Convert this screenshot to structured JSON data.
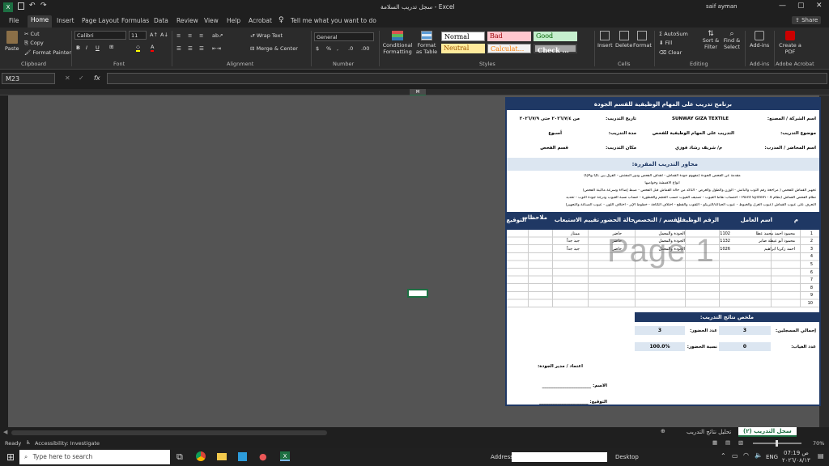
{
  "window": {
    "title": "سجل تدريب السلامة - Excel",
    "user": "saif ayman"
  },
  "menu_tabs": [
    "File",
    "Home",
    "Insert",
    "Page Layout",
    "Formulas",
    "Data",
    "Review",
    "View",
    "Help",
    "Acrobat"
  ],
  "active_tab": "Home",
  "tell_me": "Tell me what you want to do",
  "share": "Share",
  "ribbon": {
    "clipboard": {
      "paste": "Paste",
      "cut": "Cut",
      "copy": "Copy",
      "format_painter": "Format Painter",
      "group": "Clipboard"
    },
    "font": {
      "name": "Calibri",
      "size": "11",
      "group": "Font"
    },
    "alignment": {
      "wrap": "Wrap Text",
      "merge": "Merge & Center",
      "group": "Alignment"
    },
    "number": {
      "format": "General",
      "group": "Number"
    },
    "styles": {
      "conditional": "Conditional Formatting",
      "format_table": "Format as Table",
      "normal": "Normal",
      "bad": "Bad",
      "good": "Good",
      "neutral": "Neutral",
      "calculation": "Calculat...",
      "check": "Check ...",
      "group": "Styles"
    },
    "cells": {
      "insert": "Insert",
      "delete": "Delete",
      "format": "Format",
      "group": "Cells"
    },
    "editing": {
      "autosum": "AutoSum",
      "fill": "Fill",
      "clear": "Clear",
      "sort": "Sort & Filter",
      "find": "Find & Select",
      "group": "Editing"
    },
    "addins": {
      "label": "Add-ins",
      "group": "Add-ins"
    },
    "acrobat": {
      "label": "Create a PDF",
      "group": "Adobe Acrobat"
    }
  },
  "name_box": "M23",
  "fx": "fx",
  "cell_selected": "M",
  "report": {
    "title": "برنامج تدريب على المهام الوظيفية للقسم الجودة",
    "company_label": "اسم الشركة / المصنع:",
    "company_value": "SUNWAY GIZA TEXTILE",
    "date_label": "تاريخ التدريب:",
    "date_value": "من ٢٠٢٦/٧/٤ حتى ٢٠٢٦/٧/٩",
    "topic_label": "موضوع التدريب:",
    "topic_value": "التدريب على المهام الوظيفية للفحص",
    "duration_label": "مدة التدريب:",
    "duration_value": "أسبوع",
    "trainer_label": "اسم المحاضر / المدرب:",
    "trainer_value": "م/ شريف رشاد فوزي",
    "place_label": "مكان التدريب:",
    "place_value": "قسم الفحص",
    "axes_title": "محاور التدريب المقررة:",
    "axes": [
      "مقدمة عن الفحص الجودة (مفهوم جودة القماش - أهداف الفحص ودور المفتش - الفرق بين QC وQA)",
      "أنواع الأقمشة وخواصها",
      "تجهيز القماش للفحص ( مراجعة رقم الثوب والباتش - الوزن والطول والعرض - التأكد من حالة القماش قبل الفحص - ضبط إضاءة وسرعة ماكينة الفحص)",
      "نظام الفحص القماش (نظام 4 - Point System - احتساب نقاط العيوب - تصنيف العيوب حسب الحجم والخطورة - حساب نسبة العيوب ودرجة جودة الثوب - تحديد",
      "التعرف على عيوب القماش (عيوب الغزل والخيوط - عيوب الحياكة/التريكو - الثقوب والقطع - اختلاف الكثافة - خطوط الإبر - اختلاف اللون - عيوب الصباغة والتجهيز)"
    ],
    "table_headers": [
      "م",
      "اسم العامل",
      "الرقم الوظيفي",
      "القسم / التخصص",
      "حالة الحضور",
      "تقييم الاستيعاب",
      "ملاحظات",
      "التوقيع"
    ],
    "rows": [
      {
        "n": "1",
        "name": "محمود احمد محمد عطا",
        "id": "1102",
        "dept": "الجودة والمعمل",
        "status": "حاضر",
        "eval": "ممتاز"
      },
      {
        "n": "2",
        "name": "محمود أبو عيطة صابر",
        "id": "1132",
        "dept": "الجودة والمعمل",
        "status": "حاضر",
        "eval": "جيد جداً"
      },
      {
        "n": "3",
        "name": "احمد زكريا ابراهيم",
        "id": "1026",
        "dept": "الجودة والمعمل",
        "status": "حاضر",
        "eval": "جيد جداً"
      },
      {
        "n": "4",
        "name": "",
        "id": "",
        "dept": "",
        "status": "",
        "eval": ""
      },
      {
        "n": "5",
        "name": "",
        "id": "",
        "dept": "",
        "status": "",
        "eval": ""
      },
      {
        "n": "6",
        "name": "",
        "id": "",
        "dept": "",
        "status": "",
        "eval": ""
      },
      {
        "n": "7",
        "name": "",
        "id": "",
        "dept": "",
        "status": "",
        "eval": ""
      },
      {
        "n": "8",
        "name": "",
        "id": "",
        "dept": "",
        "status": "",
        "eval": ""
      },
      {
        "n": "9",
        "name": "",
        "id": "",
        "dept": "",
        "status": "",
        "eval": ""
      },
      {
        "n": "10",
        "name": "",
        "id": "",
        "dept": "",
        "status": "",
        "eval": ""
      }
    ],
    "summary_title": "ملخص نتائج التدريب:",
    "total_label": "إجمالي المسجلين:",
    "total_value": "3",
    "present_label": "عدد الحضور:",
    "present_value": "3",
    "absent_label": "عدد الغياب:",
    "absent_value": "0",
    "rate_label": "نسبة الحضور:",
    "rate_value": "100.0%",
    "approval": "اعتماد / مدير الجودة:",
    "name_line": "الاسم: ______________________",
    "sign_line": "التوقيع: ______________________",
    "watermark": "Page 1"
  },
  "sheet_tabs": [
    "سجل التدريب (٢)",
    "تحليل نتائج التدريب"
  ],
  "status": {
    "ready": "Ready",
    "accessibility": "Accessibility: Investigate",
    "zoom": "70%"
  },
  "taskbar": {
    "search": "Type here to search",
    "address": "Address",
    "desktop": "Desktop",
    "lang": "ENG",
    "time": "07:19 ص",
    "date": "٢٠٢٦/٠٨/١٣"
  }
}
